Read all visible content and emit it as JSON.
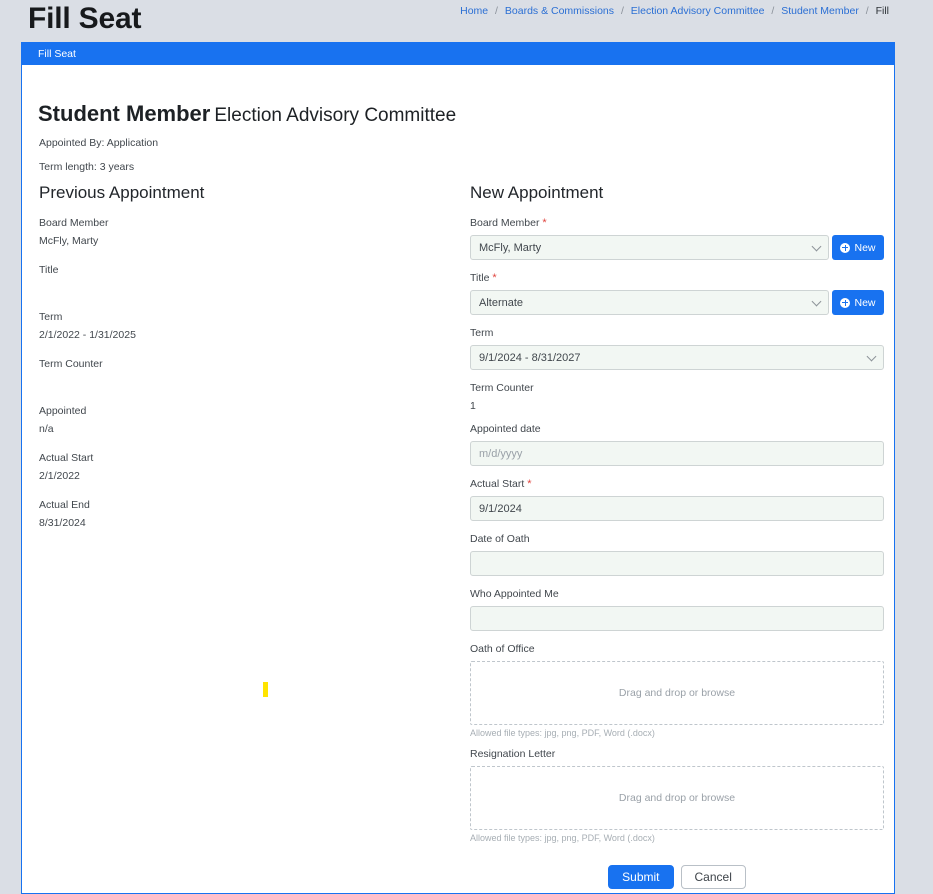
{
  "header": {
    "page_title": "Fill Seat",
    "breadcrumb": [
      {
        "label": "Home",
        "current": false
      },
      {
        "label": "Boards & Commissions",
        "current": false
      },
      {
        "label": "Election Advisory Committee",
        "current": false
      },
      {
        "label": "Student Member",
        "current": false
      },
      {
        "label": "Fill",
        "current": true
      }
    ],
    "separator": "/"
  },
  "card": {
    "title": "Fill Seat",
    "seat_name": "Student Member",
    "board_name": "Election Advisory Committee",
    "appointed_by": "Appointed By: Application",
    "term_length": "Term length: 3 years"
  },
  "previous": {
    "section_title": "Previous Appointment",
    "fields": [
      {
        "label": "Board Member",
        "value": "McFly, Marty"
      },
      {
        "label": "Title",
        "value": ""
      },
      {
        "label": "Term",
        "value": "2/1/2022 - 1/31/2025"
      },
      {
        "label": "Term Counter",
        "value": ""
      },
      {
        "label": "Appointed",
        "value": "n/a"
      },
      {
        "label": "Actual Start",
        "value": "2/1/2022"
      },
      {
        "label": "Actual End",
        "value": "8/31/2024"
      }
    ]
  },
  "new_appointment": {
    "section_title": "New Appointment",
    "board_member": {
      "label": "Board Member",
      "required": "*",
      "value": "McFly, Marty",
      "new_button": "New"
    },
    "title": {
      "label": "Title",
      "required": "*",
      "value": "Alternate",
      "new_button": "New"
    },
    "term": {
      "label": "Term",
      "value": "9/1/2024 - 8/31/2027"
    },
    "term_counter": {
      "label": "Term Counter",
      "value": "1"
    },
    "appointed_date": {
      "label": "Appointed date",
      "value": "",
      "placeholder": "m/d/yyyy"
    },
    "actual_start": {
      "label": "Actual Start",
      "required": "*",
      "value": "9/1/2024"
    },
    "date_of_oath": {
      "label": "Date of Oath",
      "value": ""
    },
    "who_appointed_me": {
      "label": "Who Appointed Me",
      "value": ""
    },
    "oath_of_office": {
      "label": "Oath of Office",
      "dropzone_text": "Drag and drop or browse",
      "allowed_types": "Allowed file types: jpg, png, PDF, Word (.docx)"
    },
    "resignation_letter": {
      "label": "Resignation Letter",
      "dropzone_text": "Drag and drop or browse",
      "allowed_types": "Allowed file types: jpg, png, PDF, Word (.docx)"
    },
    "submit_button": "Submit",
    "cancel_button": "Cancel"
  },
  "colors": {
    "accent_blue": "#1872f0",
    "page_background": "#dadee5",
    "required_red": "#e0443e",
    "highlight_yellow": "#ffe400"
  }
}
